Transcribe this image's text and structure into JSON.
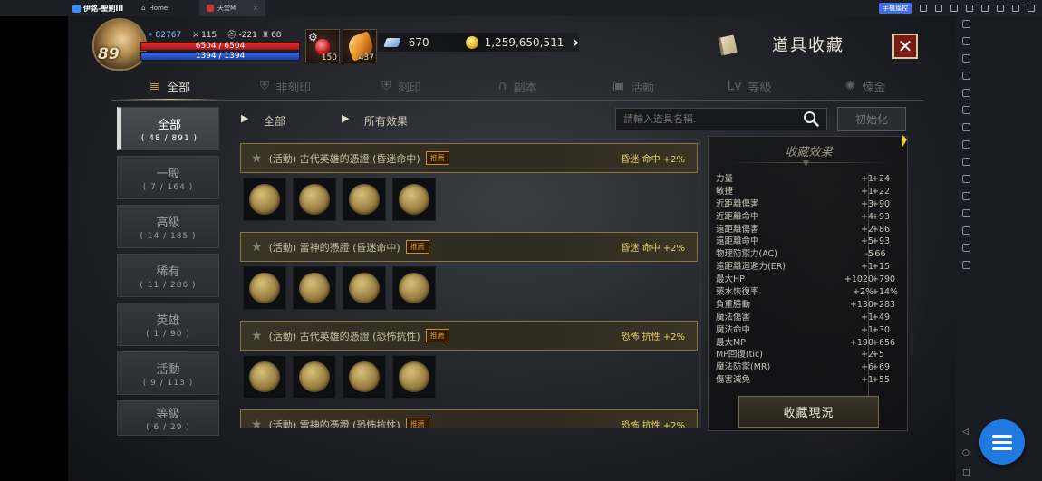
{
  "emulator": {
    "app_name": "伊銘-聖劍III",
    "tabs": [
      {
        "label": "Home"
      },
      {
        "label": "天堂M"
      }
    ],
    "stream_label": "手機遙控"
  },
  "hud": {
    "level": "89",
    "blue_stat": "82767",
    "attack": "115",
    "defense": "-221",
    "trophy": "68",
    "hp": "6504 / 6504",
    "mp": "1394 / 1394",
    "potion_count": "150",
    "feather_count": "437",
    "diamonds": "670",
    "gold": "1,259,650,511"
  },
  "window": {
    "title": "道具收藏",
    "close_label": "✕"
  },
  "category_tabs": [
    {
      "label": "全部",
      "icon": "card-icon"
    },
    {
      "label": "非刻印",
      "icon": "shield-icon"
    },
    {
      "label": "刻印",
      "icon": "shield-icon"
    },
    {
      "label": "副本",
      "icon": "helmet-icon"
    },
    {
      "label": "活動",
      "icon": "gift-icon"
    },
    {
      "label": "等級",
      "icon": "lv-icon"
    },
    {
      "label": "煉金",
      "icon": "flask-icon"
    }
  ],
  "grades": [
    {
      "label": "全部",
      "count": "( 48 / 891 )"
    },
    {
      "label": "一般",
      "count": "( 7 / 164 )"
    },
    {
      "label": "高級",
      "count": "( 14 / 185 )"
    },
    {
      "label": "稀有",
      "count": "( 11 / 286 )"
    },
    {
      "label": "英雄",
      "count": "( 1 / 90 )"
    },
    {
      "label": "活動",
      "count": "( 9 / 113 )"
    },
    {
      "label": "等級",
      "count": "( 6 / 29 )"
    }
  ],
  "filters": {
    "category": "全部",
    "effect": "所有效果",
    "search_placeholder": "請輸入道具名稱.",
    "reset_label": "初始化"
  },
  "items": [
    {
      "name": "(活動) 古代英雄的憑證 (昏迷命中)",
      "badge": "推薦",
      "effect": "昏迷 命中 +2%"
    },
    {
      "name": "(活動) 雷神的憑證 (昏迷命中)",
      "badge": "推薦",
      "effect": "昏迷 命中 +2%"
    },
    {
      "name": "(活動) 古代英雄的憑證 (恐怖抗性)",
      "badge": "推薦",
      "effect": "恐怖 抗性 +2%"
    },
    {
      "name": "(活動) 雷神的憑證 (恐怖抗性)",
      "badge": "推薦",
      "effect": "恐怖 抗性 +2%"
    }
  ],
  "effects_panel": {
    "title": "收藏效果",
    "rows": [
      {
        "name": "力量",
        "add": "+1",
        "total": "+24"
      },
      {
        "name": "敏捷",
        "add": "+1",
        "total": "+22"
      },
      {
        "name": "近距離傷害",
        "add": "+3",
        "total": "+90"
      },
      {
        "name": "近距離命中",
        "add": "+4",
        "total": "+93"
      },
      {
        "name": "遠距離傷害",
        "add": "+2",
        "total": "+86"
      },
      {
        "name": "遠距離命中",
        "add": "+5",
        "total": "+93"
      },
      {
        "name": "物理防禦力(AC)",
        "add": "-5",
        "total": "-66"
      },
      {
        "name": "遠距離迴避力(ER)",
        "add": "+1",
        "total": "+15"
      },
      {
        "name": "最大HP",
        "add": "+1020",
        "total": "+790"
      },
      {
        "name": "藥水恢復率",
        "add": "+2%",
        "total": "+14%"
      },
      {
        "name": "負重勝動",
        "add": "+130",
        "total": "+283"
      },
      {
        "name": "魔法傷害",
        "add": "+1",
        "total": "+49"
      },
      {
        "name": "魔法命中",
        "add": "+1",
        "total": "+30"
      },
      {
        "name": "最大MP",
        "add": "+190",
        "total": "+656"
      },
      {
        "name": "MP回復(tic)",
        "add": "+2",
        "total": "+5"
      },
      {
        "name": "魔法防禦(MR)",
        "add": "+6",
        "total": "+69"
      },
      {
        "name": "傷害減免",
        "add": "+1",
        "total": "+55"
      }
    ],
    "status_button": "收藏現況"
  }
}
